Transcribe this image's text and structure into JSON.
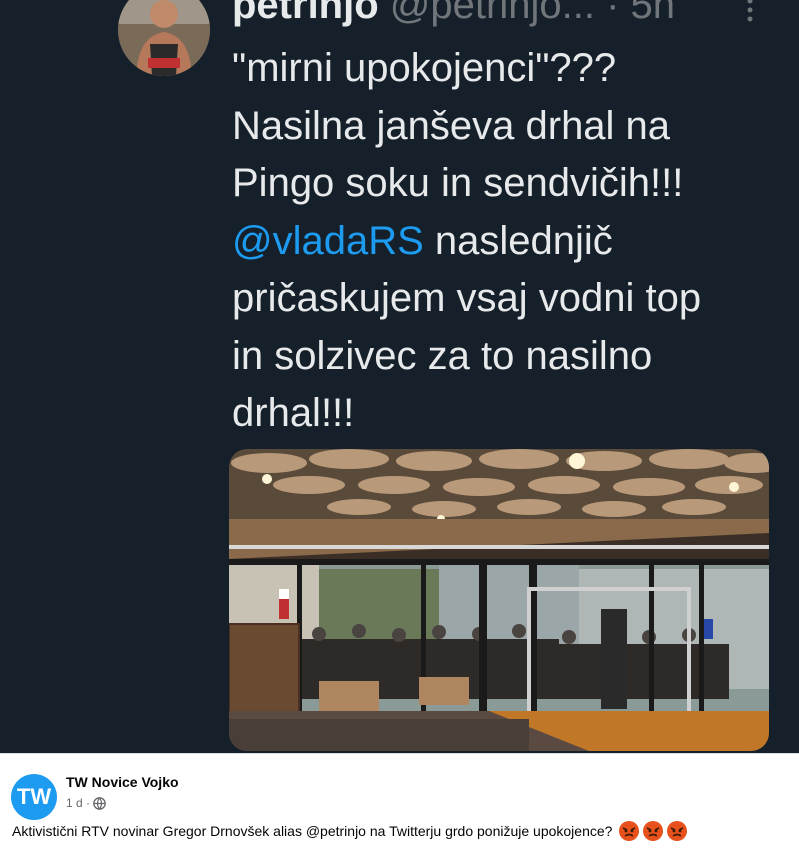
{
  "tweet": {
    "display_name": "petrinjo",
    "username": "@petrinjo...",
    "separator": "·",
    "time": "5h",
    "avatar_icon": "profile-photo-avatar",
    "more_icon": "vertical-ellipsis-icon",
    "text_lines": [
      {
        "text": "\"mirni upokojenci\"???"
      },
      {
        "text": "Nasilna janševa drhal na"
      },
      {
        "text": "Pingo soku in sendvičih!!!"
      },
      {
        "mention": "@vladaRS",
        "text": " naslednjič"
      },
      {
        "text": "pričaskujem vsaj vodni top"
      },
      {
        "text": "in solzivec za to nasilno"
      },
      {
        "text": "drhal!!!"
      }
    ],
    "media": {
      "type": "photo",
      "description_icon": "building-lobby-photo"
    },
    "colors": {
      "background": "#15202b",
      "text": "#e7e9ea",
      "muted": "#71767b",
      "link": "#1d9bf0"
    }
  },
  "fb_post": {
    "page_name": "TW Novice Vojko",
    "avatar_text": "TW",
    "timestamp": "1 d ·",
    "privacy_icon": "globe-icon",
    "text": "Aktivistični RTV novinar Gregor Drnovšek alias @petrinjo na Twitterju grdo ponižuje upokojence?",
    "reactions": [
      "angry-face-emoji",
      "angry-face-emoji",
      "angry-face-emoji"
    ],
    "colors": {
      "avatar": "#1d9bf0"
    }
  }
}
